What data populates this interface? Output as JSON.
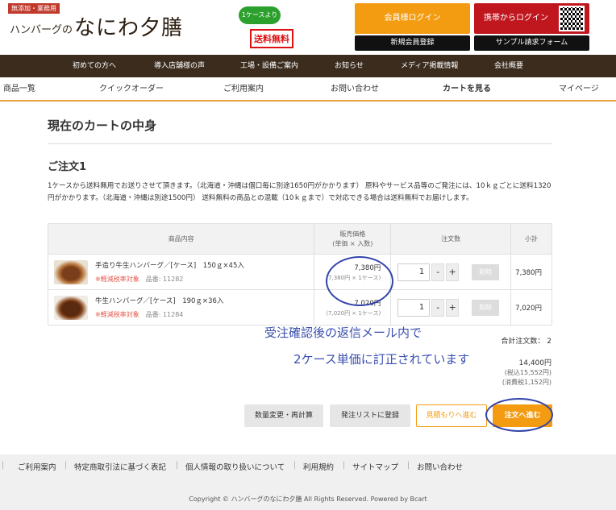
{
  "header": {
    "logo_tag": "無添加・業務用",
    "logo_sub": "ハンバーグの",
    "logo_main": "なにわ夕膳",
    "promo_badge": "1ケースより",
    "promo_free": "送料無料",
    "login": "会員様ログイン",
    "mobile_login": "携帯からログイン",
    "register": "新規会員登録",
    "sample": "サンプル請求フォーム"
  },
  "main_nav": [
    "初めての方へ",
    "導入店舗様の声",
    "工場・設備ご案内",
    "お知らせ",
    "メディア掲載情報",
    "会社概要"
  ],
  "sub_nav": [
    "商品一覧",
    "クイックオーダー",
    "ご利用案内",
    "お問い合わせ",
    "カートを見る",
    "マイページ"
  ],
  "page_title": "現在のカートの中身",
  "order": {
    "title": "ご注文1",
    "notice": "1ケースから送料無用でお送りさせて頂きます。（北海道・沖縄は個口毎に別途1650円がかかります） 原料やサービス品等のご発注には、10ｋｇごとに送料1320円がかかります。（北海道・沖縄は別途1500円） 送料無料の商品との混載（10ｋｇまで）で対応できる場合は送料無料でお届けします。",
    "columns": {
      "product": "商品内容",
      "price": "販売価格",
      "price_note": "(単価 × 入数)",
      "qty": "注文数",
      "subtotal": "小計"
    },
    "items": [
      {
        "name": "手造り牛生ハンバーグ／[ケース]　150ｇ×45入",
        "tax": "※軽減税率対象",
        "code": "品番: 11282",
        "price": "7,380円",
        "unit": "(7,380円 × 1ケース)",
        "qty": "1",
        "delete": "削除",
        "subtotal": "7,380円"
      },
      {
        "name": "牛生ハンバーグ／[ケース]　190ｇ×36入",
        "tax": "※軽減税率対象",
        "code": "品番: 11284",
        "price": "7,020円",
        "unit": "(7,020円 × 1ケース)",
        "qty": "1",
        "delete": "削除",
        "subtotal": "7,020円"
      }
    ],
    "minus": "-",
    "plus": "+",
    "total_qty": "合計注文数： 2",
    "total": "14,400円",
    "total_tax_incl": "(税込15,552円)",
    "tax_amount": "(消費税1,152円)"
  },
  "annotation": {
    "line1": "受注確認後の返信メール内で",
    "line2": "2ケース単価に訂正されています"
  },
  "actions": {
    "recalc": "数量変更・再計算",
    "order_list": "発注リストに登録",
    "estimate": "見積もりへ進む",
    "checkout": "注文へ進む"
  },
  "footer": {
    "links": [
      "ご利用案内",
      "特定商取引法に基づく表記",
      "個人情報の取り扱いについて",
      "利用規約",
      "サイトマップ",
      "お問い合わせ"
    ],
    "copyright": "Copyright © ハンバーグのなにわ夕膳 All Rights Reserved. Powered by Bcart"
  }
}
